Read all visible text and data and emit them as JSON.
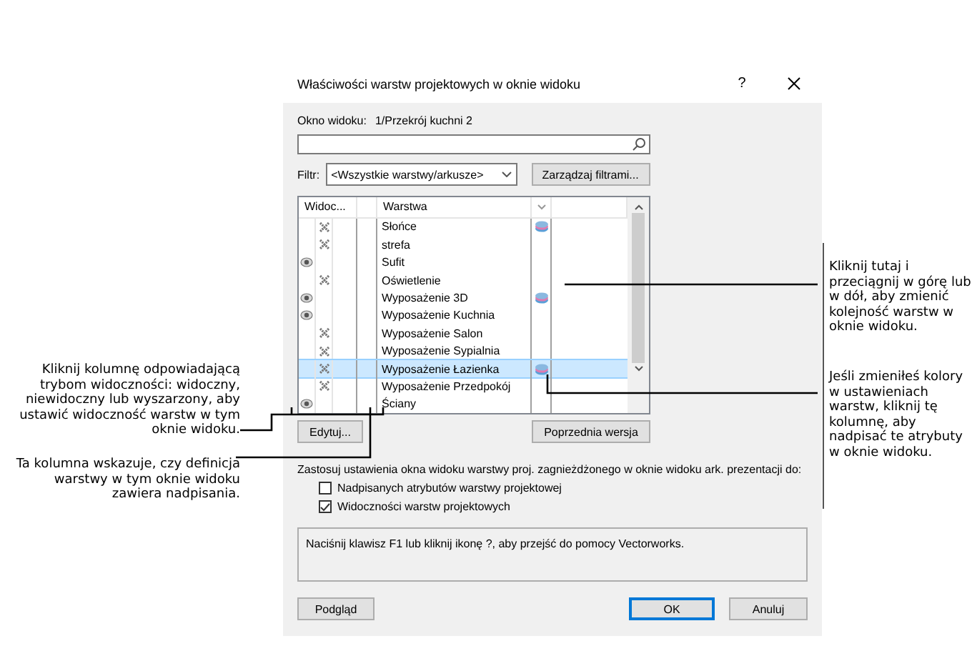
{
  "window": {
    "title": "Właściwości warstw projektowych w oknie widoku",
    "help": "?"
  },
  "viewport_label": "Okno widoku:",
  "viewport_name": "1/Przekrój kuchni 2",
  "filter": {
    "label": "Filtr:",
    "value": "<Wszystkie warstwy/arkusze>",
    "manage_button": "Zarządzaj filtrami..."
  },
  "table": {
    "columns": [
      "Widoc...",
      "Warstwa"
    ],
    "rows": [
      {
        "name": "Słońce",
        "visible": false,
        "color_override": true,
        "selected": false
      },
      {
        "name": "strefa",
        "visible": false,
        "color_override": false,
        "selected": false
      },
      {
        "name": "Sufit",
        "visible": true,
        "color_override": false,
        "selected": false
      },
      {
        "name": "Oświetlenie",
        "visible": false,
        "color_override": false,
        "selected": false
      },
      {
        "name": "Wyposażenie 3D",
        "visible": true,
        "color_override": true,
        "selected": false
      },
      {
        "name": "Wyposażenie Kuchnia",
        "visible": true,
        "color_override": false,
        "selected": false
      },
      {
        "name": "Wyposażenie Salon",
        "visible": false,
        "color_override": false,
        "selected": false
      },
      {
        "name": "Wyposażenie Sypialnia",
        "visible": false,
        "color_override": false,
        "selected": false
      },
      {
        "name": "Wyposażenie Łazienka",
        "visible": false,
        "color_override": true,
        "selected": true
      },
      {
        "name": "Wyposażenie Przedpokój",
        "visible": false,
        "color_override": false,
        "selected": false
      },
      {
        "name": "Ściany",
        "visible": true,
        "color_override": false,
        "selected": false
      }
    ]
  },
  "edit_button": "Edytuj...",
  "revert_button": "Poprzednia wersja",
  "apply_text": "Zastosuj ustawienia okna widoku warstwy proj. zagnieżdżonego w oknie widoku ark. prezentacji do:",
  "options": [
    {
      "label": "Nadpisanych atrybutów warstwy projektowej",
      "checked": false
    },
    {
      "label": "Widoczności warstw projektowych",
      "checked": true
    }
  ],
  "help_text": "Naciśnij klawisz F1 lub kliknij ikonę ?, aby przejść do pomocy Vectorworks.",
  "buttons": {
    "preview": "Podgląd",
    "ok": "OK",
    "cancel": "Anuluj"
  },
  "callouts": [
    {
      "text": "Kliknij kolumnę odpowiadającą trybom widoczności: widoczny, niewidoczny lub wyszarzony, aby ustawić widoczność warstw w tym oknie widoku."
    },
    {
      "text": "Ta kolumna wskazuje, czy definicja warstwy w tym oknie widoku zawiera nadpisania."
    },
    {
      "text": "Kliknij tutaj i przeciągnij w górę lub w dół, aby zmienić kolejność warstw w oknie widoku."
    },
    {
      "text": "Jeśli zmieniłeś kolory w ustawieniach warstw, kliknij tę kolumnę, aby nadpisać te atrybuty w oknie widoku."
    }
  ]
}
